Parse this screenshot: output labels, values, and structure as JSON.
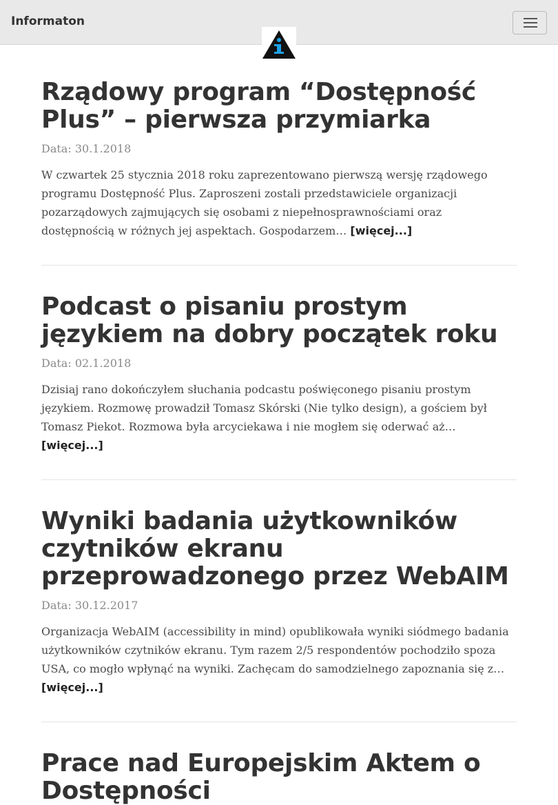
{
  "brand": "Informaton",
  "logo": {
    "glyph": "i",
    "bg": "#ffffff",
    "triangle": "#111111",
    "accent": "#1ea0e6"
  },
  "nav": {
    "toggle_icon": "hamburger-menu-icon"
  },
  "date_label": "Data:",
  "more_label": "[więcej...]",
  "posts": [
    {
      "title": "Rządowy program “Dostępność Plus” – pierwsza przymiarka",
      "date": "30.1.2018",
      "excerpt": "W czwartek 25 stycznia 2018 roku zaprezentowano pierwszą wersję rządowego programu Dostępność Plus. Zaproszeni zostali przedstawiciele organizacji pozarządowych zajmujących się osobami z niepełnosprawnościami oraz dostępnością w różnych jej aspektach. Gospodarzem…"
    },
    {
      "title": "Podcast o pisaniu prostym językiem na dobry początek roku",
      "date": "02.1.2018",
      "excerpt": "Dzisiaj rano dokończyłem słuchania podcastu poświęconego pisaniu prostym językiem. Rozmowę prowadził Tomasz Skórski (Nie tylko design), a gościem był Tomasz Piekot. Rozmowa była arcyciekawa i nie mogłem się oderwać aż…"
    },
    {
      "title": "Wyniki badania użytkowników czytników ekranu przeprowadzonego przez WebAIM",
      "date": "30.12.2017",
      "excerpt": "Organizacja WebAIM (accessibility in mind) opublikowała wyniki siódmego badania użytkowników czytników ekranu. Tym razem 2/5 respondentów pochodziło spoza USA, co mogło wpłynąć na wyniki. Zachęcam do samodzielnego zapoznania się z…"
    },
    {
      "title": "Prace nad Europejskim Aktem o Dostępności"
    }
  ]
}
